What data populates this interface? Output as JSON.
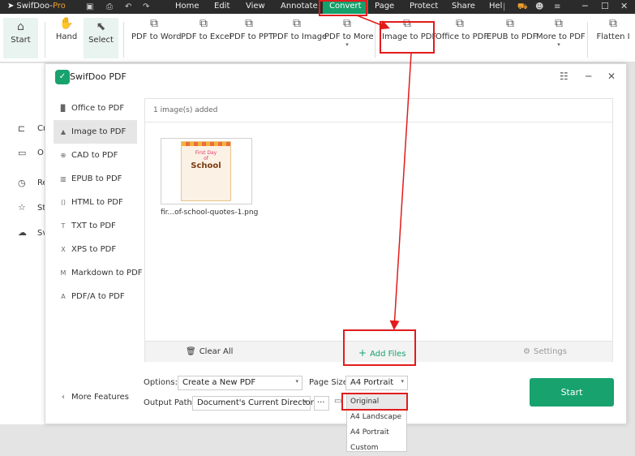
{
  "titlebar": {
    "brand_main": "SwifDoo-",
    "brand_pro": "Pro",
    "menus": [
      "Home",
      "Edit",
      "View",
      "Annotate",
      "Convert",
      "Page",
      "Protect",
      "Share",
      "Hel"
    ]
  },
  "ribbon": {
    "start": "Start",
    "hand": "Hand",
    "select": "Select",
    "tools": [
      "PDF to Word",
      "PDF to Excel",
      "PDF to PPT",
      "PDF to Image",
      "PDF to More",
      "Image to PDF",
      "Office to PDF",
      "EPUB to PDF",
      "More to PDF",
      "Flatten I"
    ]
  },
  "left_strip": [
    "Cr",
    "O",
    "Re",
    "St",
    "Sv"
  ],
  "dialog": {
    "title": "SwifDoo PDF",
    "sidebar": [
      {
        "label": "Office to PDF",
        "icon": "office-icon"
      },
      {
        "label": "Image to PDF",
        "icon": "image-icon"
      },
      {
        "label": "CAD to PDF",
        "icon": "cad-icon"
      },
      {
        "label": "EPUB to PDF",
        "icon": "epub-icon"
      },
      {
        "label": "HTML to PDF",
        "icon": "html-icon"
      },
      {
        "label": "TXT to PDF",
        "icon": "txt-icon"
      },
      {
        "label": "XPS to PDF",
        "icon": "xps-icon"
      },
      {
        "label": "Markdown to PDF",
        "icon": "markdown-icon"
      },
      {
        "label": "PDF/A to PDF",
        "icon": "pdfa-icon"
      }
    ],
    "more_features": "More Features",
    "count": "1 image(s) added",
    "file": {
      "name": "fir...of-school-quotes-1.png",
      "poster_line1": "First Day",
      "poster_line2": "of",
      "poster_line3": "School"
    },
    "actions": {
      "clear_all": "Clear All",
      "add_files": "Add Files",
      "settings": "Settings"
    },
    "options_label": "Options:",
    "options_value": "Create a New PDF",
    "page_size_label": "Page Size:",
    "page_size_value": "A4 Portrait",
    "output_label": "Output Path:",
    "output_value": "Document's Current Directory",
    "dots": "···",
    "start": "Start",
    "dropdown": [
      "Original",
      "A4 Landscape",
      "A4 Portrait",
      "Custom"
    ]
  },
  "colors": {
    "accent": "#17a26e",
    "highlight": "#e21b1b"
  }
}
